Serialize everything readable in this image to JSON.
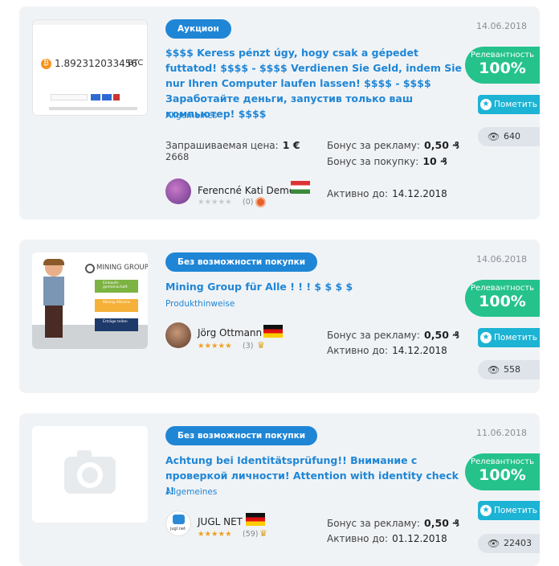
{
  "listings": [
    {
      "badge": "Аукцион",
      "date": "14.06.2018",
      "title": "$$$$ Keress pénzt úgy, hogy csak a gépedet futtatod! $$$$ - $$$$ Verdienen Sie Geld, indem Sie nur Ihren Computer laufen lassen! $$$$ - $$$$ Заработайте деньги, запустив только ваш компьютер! $$$$",
      "category": "Allgemeines",
      "thumb_btc": "1.892312033456",
      "thumb_btc_unit": "BTC",
      "price_label": "Запрашиваемая цена:",
      "price_value": "1 €",
      "price_sub": "2668",
      "bonus_ad_label": "Бонус за рекламу:",
      "bonus_ad_value": "0,50 ₰",
      "bonus_buy_label": "Бонус за покупку:",
      "bonus_buy_value": "10 ₰",
      "active_label": "Активно до:",
      "active_value": "14.12.2018",
      "username": "Ferencné Kati Deme",
      "stars": "★★★★★",
      "rating_count": "(0)",
      "relevance_label": "Релевантность",
      "relevance_value": "100%",
      "mark_label": "Пометить",
      "views": "640"
    },
    {
      "badge": "Без возможности покупки",
      "date": "14.06.2018",
      "title": "Mining Group für Alle ! ! ! $ $ $ $",
      "category": "Produkthinweise",
      "thumb_brand": "MINING GROUP",
      "thumb_items": [
        "Einkaufs-gemeinschaft",
        "Mining Altcoins",
        "Erträge teilen"
      ],
      "bonus_ad_label": "Бонус за рекламу:",
      "bonus_ad_value": "0,50 ₰",
      "active_label": "Активно до:",
      "active_value": "14.12.2018",
      "username": "Jörg Ottmann",
      "stars": "★★★★★",
      "rating_count": "(3)",
      "relevance_label": "Релевантность",
      "relevance_value": "100%",
      "mark_label": "Пометить",
      "views": "558"
    },
    {
      "badge": "Без возможности покупки",
      "date": "11.06.2018",
      "title": "Achtung bei Identitätsprüfung!! Внимание с проверкой личности! Attention with identity check !!",
      "category": "Allgemeines",
      "bonus_ad_label": "Бонус за рекламу:",
      "bonus_ad_value": "0,50 ₰",
      "active_label": "Активно до:",
      "active_value": "01.12.2018",
      "username": "JUGL NET",
      "avatar_text": "jugl.net",
      "stars": "★★★★★",
      "rating_count": "(59)",
      "relevance_label": "Релевантность",
      "relevance_value": "100%",
      "mark_label": "Пометить",
      "views": "22403"
    }
  ],
  "colors": {
    "accent": "#1f86d6",
    "relevance": "#25c28c",
    "mark": "#1cb3d4",
    "star": "#f0a020"
  }
}
